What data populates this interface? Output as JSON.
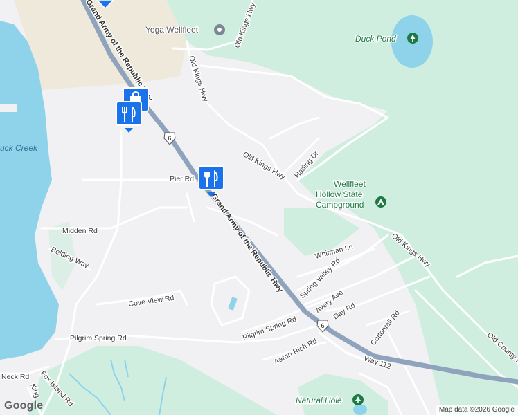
{
  "map": {
    "colors": {
      "water": "#8fd3ea",
      "land": "#f1f1f3",
      "park": "#cfeee0",
      "sand": "#efe9dc",
      "highway": "#8fa3bd",
      "road": "#ffffff",
      "poi_green": "#1e7a43",
      "marker_blue": "#1a73e8"
    },
    "road_labels": {
      "grand_army_top": "Grand Army of the Republic Hwy",
      "grand_army_mid": "Grand Army of the Republic Hwy",
      "old_kings_top": "Old Kings Hwy",
      "old_kings_left": "Old Kings Hwy",
      "old_kings_center": "Old Kings Hwy",
      "old_kings_right": "Old Kings Hwy",
      "hading": "Hading Dr",
      "pier": "Pier Rd",
      "midden": "Midden Rd",
      "belding": "Belding Way",
      "whitman": "Whitman Ln",
      "spring_valley": "Spring Valley Rd",
      "avery": "Avery Ave",
      "day": "Day Rd",
      "cove_view": "Cove View Rd",
      "pilgrim_spring_left": "Pilgrim Spring Rd",
      "pilgrim_spring_right": "Pilgrim Spring Rd",
      "aaron_rich": "Aaron Rich Rd",
      "cottontail": "Cottontail Rd",
      "old_county": "Old County Rd",
      "way_112": "Way 112",
      "neck": "Neck Rd",
      "fox_island": "Fox Island Rd",
      "king": "King"
    },
    "route_shields": [
      "6",
      "6"
    ],
    "pois": {
      "yoga": "Yoga Wellfleet",
      "duck_pond": "Duck Pond",
      "campground_line1": "Wellfleet",
      "campground_line2": "Hollow State",
      "campground_line3": "Campground",
      "natural_hole": "Natural Hole",
      "duck_creek": "uck Creek"
    },
    "icons": [
      "shopping-bag-icon",
      "restaurant-icon",
      "restaurant-icon",
      "tree-icon",
      "camping-icon",
      "place-icon"
    ]
  },
  "footer": {
    "logo": "Google",
    "attribution": "Map data ©2026 Google"
  }
}
